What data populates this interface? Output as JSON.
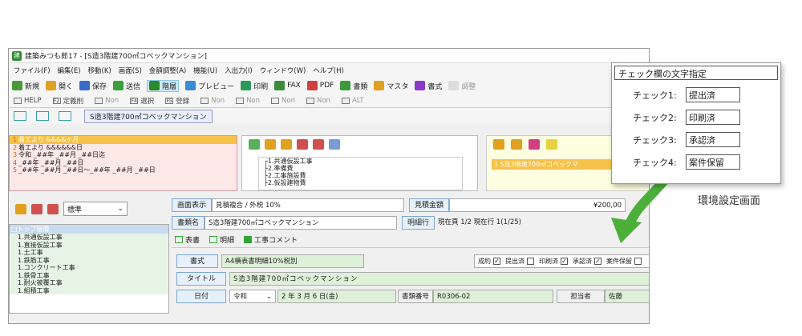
{
  "window": {
    "title": "建築みつも郎17 - [S造3階建700㎡コベックマンション]",
    "app_icon": "建"
  },
  "menu": [
    "ファイル(F)",
    "編集(E)",
    "移動(K)",
    "画面(S)",
    "金額調整(A)",
    "機能(U)",
    "入出力(I)",
    "ウィンドウ(W)",
    "ヘルプ(H)"
  ],
  "toolbar": [
    {
      "label": "新規",
      "icon": "new-icon",
      "color": "#4a9a3a"
    },
    {
      "label": "開く",
      "icon": "open-icon",
      "color": "#e0a020"
    },
    {
      "label": "保存",
      "icon": "save-icon",
      "color": "#3a6ac8"
    },
    {
      "label": "送信",
      "icon": "send-icon",
      "color": "#3aa03a"
    },
    {
      "label": "階層",
      "icon": "hierarchy-icon",
      "color": "#2a8a2a"
    },
    {
      "label": "プレビュー",
      "icon": "preview-icon",
      "color": "#3a8ad8"
    },
    {
      "label": "印刷",
      "icon": "print-icon",
      "color": "#2a9a5a"
    },
    {
      "label": "FAX",
      "icon": "fax-icon",
      "color": "#3a8a3a"
    },
    {
      "label": "PDF",
      "icon": "pdf-icon",
      "color": "#d04040"
    },
    {
      "label": "書類",
      "icon": "documents-icon",
      "color": "#3a9a3a"
    },
    {
      "label": "マスタ",
      "icon": "master-icon",
      "color": "#e0a020"
    },
    {
      "label": "書式",
      "icon": "format-icon",
      "color": "#8a3ac8"
    },
    {
      "label": "調整",
      "icon": "adjust-icon",
      "color": "#aaaaaa"
    }
  ],
  "fkeys": [
    {
      "key": "",
      "label": "HELP",
      "dim": false
    },
    {
      "key": "F2",
      "label": "定義削",
      "dim": false
    },
    {
      "key": "",
      "label": "Non",
      "dim": true
    },
    {
      "key": "F4",
      "label": "選択",
      "dim": false
    },
    {
      "key": "F5",
      "label": "登録",
      "dim": false
    },
    {
      "key": "",
      "label": "Non",
      "dim": true
    },
    {
      "key": "",
      "label": "Non",
      "dim": true
    },
    {
      "key": "",
      "label": "Non",
      "dim": true
    },
    {
      "key": "",
      "label": "Non",
      "dim": true
    },
    {
      "key": "",
      "label": "ALT",
      "dim": true
    }
  ],
  "view_tab": "S造3階建700㎡コベックマンション",
  "paneA_lines": [
    {
      "n": "1",
      "text": "着工より &&&&ヶ月",
      "hl": true
    },
    {
      "n": "2",
      "text": "着工より &&&&&&日",
      "hl": false
    },
    {
      "n": "3",
      "text": "令和 _##年 _##月 _##日迄",
      "hl": false
    },
    {
      "n": "4",
      "text": "_##年 _##月 _##日",
      "hl": false
    },
    {
      "n": "5",
      "text": "_##年 _##月 _##日～_##年 _##月 _##日",
      "hl": false
    }
  ],
  "tree_items": [
    "┌1.共通仮設工事",
    "  ├2.準備費",
    "  ├2.工事施設費",
    "  ├2.仮設建物費"
  ],
  "paneC_sel": "1  S造3階建700㎡コベックマ",
  "left": {
    "select": "標準",
    "list_header": "□トップ階層",
    "items": [
      "1.共通仮設工事",
      "1.直接仮設工事",
      "1.土工事",
      "1.鉄筋工事",
      "1.コンクリート工事",
      "1.鉄骨工事",
      "1.耐火被覆工事",
      "1.組積工事"
    ]
  },
  "fields": {
    "screen_label": "画面表示",
    "screen_value": "見積複合 / 外税 10%",
    "estimate_label": "見積金額",
    "estimate_value": "¥200,00",
    "docname_label": "書類名",
    "docname_value": "S造3階建700㎡コベックマンション",
    "detail_label": "明細行",
    "detail_value": "現在頁 1/2  現在行 1(1/25)"
  },
  "tabs": [
    "表書",
    "明細",
    "工事コメント"
  ],
  "format_label": "書式",
  "format_value": "A4横表書明細10%税別",
  "checks": [
    {
      "label": "成約",
      "checked": true
    },
    {
      "label": "提出済",
      "checked": false
    },
    {
      "label": "印刷済",
      "checked": true
    },
    {
      "label": "承認済",
      "checked": true
    },
    {
      "label": "案件保留",
      "checked": false
    }
  ],
  "title_label": "タイトル",
  "title_value": "S造3階建700㎡コベックマンション",
  "date_label": "日付",
  "era": "令和",
  "date_year": "2",
  "date_year_unit": "年",
  "date_month": "3",
  "date_month_unit": "月",
  "date_day": "6",
  "date_day_unit": "日(金)",
  "docno_label": "書類番号",
  "docno_value": "R0306-02",
  "person_label": "担当者",
  "person_value": "佐藤",
  "popup": {
    "header": "チェック欄の文字指定",
    "rows": [
      {
        "label": "チェック1:",
        "value": "提出済"
      },
      {
        "label": "チェック2:",
        "value": "印刷済"
      },
      {
        "label": "チェック3:",
        "value": "承認済"
      },
      {
        "label": "チェック4:",
        "value": "案件保留"
      }
    ]
  },
  "caption": "環境設定画面",
  "colors": {
    "accent_green": "#3aa03a",
    "arrow_green": "#4caf3a"
  }
}
